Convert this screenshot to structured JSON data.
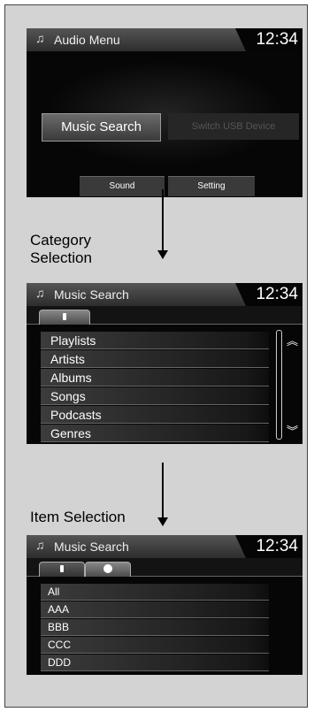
{
  "audio_menu": {
    "title": "Audio Menu",
    "clock": "12:34",
    "music_search_button": "Music Search",
    "switch_usb_button": "Switch USB Device",
    "sound_button": "Sound",
    "setting_button": "Setting"
  },
  "category_label": "Category\nSelection",
  "category_screen": {
    "title": "Music Search",
    "clock": "12:34",
    "items": [
      "Playlists",
      "Artists",
      "Albums",
      "Songs",
      "Podcasts",
      "Genres"
    ]
  },
  "item_label": "Item Selection",
  "item_screen": {
    "title": "Music Search",
    "clock": "12:34",
    "items": [
      "All",
      "AAA",
      "BBB",
      "CCC",
      "DDD"
    ]
  },
  "colors": {
    "panel_bg": "#d3d3d3",
    "screen_bg": "#060606"
  },
  "icons": [
    "music-note-icon",
    "usb-device-icon",
    "disc-icon",
    "scroll-up-icon",
    "scroll-down-icon"
  ]
}
